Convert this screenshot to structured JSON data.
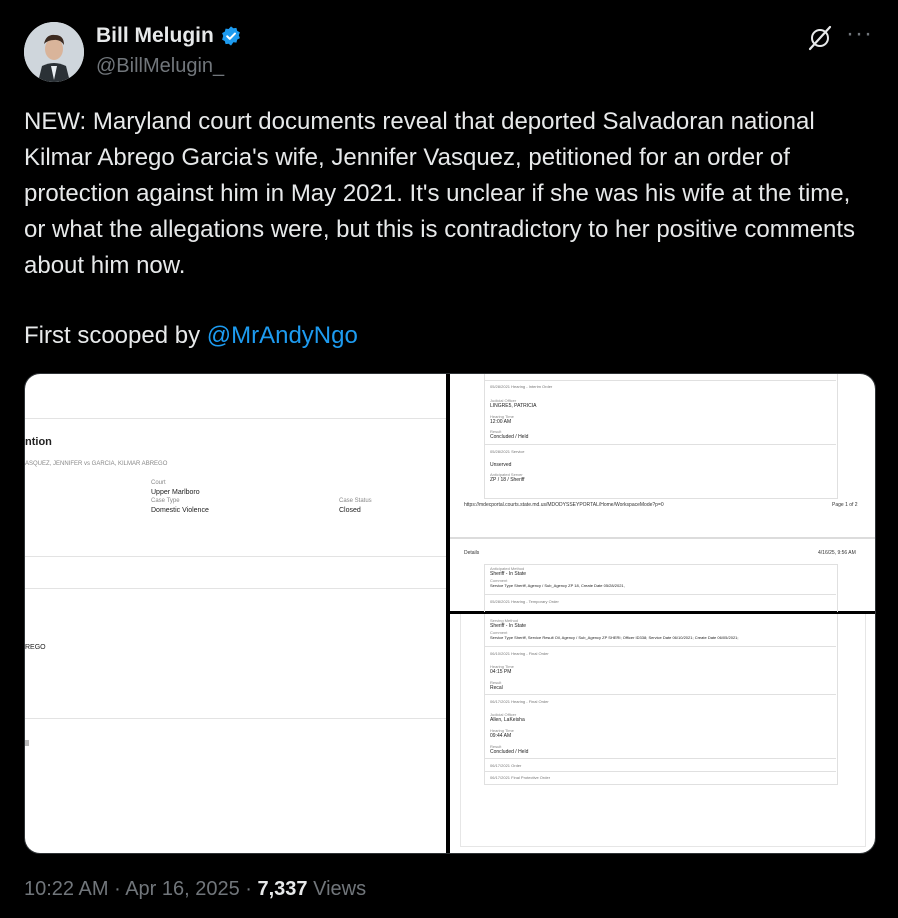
{
  "author": {
    "name": "Bill Melugin",
    "handle": "@BillMelugin_",
    "verified": true
  },
  "icons": {
    "verified": "verified-badge-icon",
    "grok": "grok-icon",
    "more": "more-options-icon"
  },
  "colors": {
    "link": "#1d9bf0",
    "verified": "#1d9bf0",
    "muted": "#71767b",
    "background": "#000000"
  },
  "tweet": {
    "text": "NEW: Maryland court documents reveal that deported Salvadoran national Kilmar Abrego Garcia's wife, Jennifer Vasquez, petitioned for an order of protection against him in May 2021. It's unclear if she was his wife at the time, or what the allegations were, but this is contradictory to her positive comments about him now.",
    "scoop_prefix": "First scooped by ",
    "scoop_mention": "@MrAndyNgo"
  },
  "media": {
    "left": {
      "heading": "ntion",
      "case_title": "ASQUEZ, JENNIFER vs GARCIA, KILMAR ABREGO",
      "court_label": "Court",
      "court_value": "Upper Marlboro",
      "case_type_label": "Case Type",
      "case_type_value": "Domestic Violence",
      "case_status_label": "Case Status",
      "case_status_value": "Closed",
      "party_fragment": "REGO"
    },
    "top_right": {
      "line1": "05/28/2021 Hearing - Interim Order",
      "judicial_label": "Judicial Officer",
      "judicial_value": "LINGRE5, PATRICIA",
      "hearing_time_label": "Hearing Time",
      "hearing_time_value": "12:00 AM",
      "result_label": "Result",
      "result_value": "Concluded / Held",
      "service_line": "05/28/2021 Service",
      "unserved": "Unserved",
      "anticipated_label": "Anticipated Server",
      "anticipated_value": "ZP / 18 / Sheriff",
      "url": "https://mdecportal.courts.state.md.us/MDODYSSEYPORTAL/Home/WorkspaceMode?p=0",
      "page": "Page 1 of 2",
      "details": "Details",
      "date": "4/16/25, 9:56 AM",
      "method_label": "Anticipated Method",
      "method_value": "Sheriff - In State",
      "comment_label": "Comment",
      "comment_value": "Service Type Sheriff, Agency / Sub_Agency ZP 18, Create Date 05/28/2021,",
      "temp_order": "05/28/2021 Hearing - Temporary Order"
    },
    "bottom_right": {
      "method_label": "Serving Method",
      "method_value": "Sheriff - In State",
      "comment_label": "Comment",
      "comment_value": "Service Type Sheriff, Service Result Oil, Agency / Sub_Agency ZP SHERI; Officer ID338; Service Date 06/10/2021; Create Date 06/05/2021;",
      "final_order1": "06/10/2021 Hearing - Final Order",
      "hearing_time_label": "Hearing Time",
      "hearing_time_value": "04:15 PM",
      "result_label": "Result",
      "result_value": "Recal",
      "final_order2": "06/17/2021 Hearing - Final Order",
      "judicial_label": "Judicial Officer",
      "judicial_value": "Allen, LaKeisha",
      "hearing_time2_label": "Hearing Time",
      "hearing_time2_value": "09:44 AM",
      "result2_label": "Result",
      "result2_value": "Concluded / Held",
      "order_line": "06/17/2021 Order",
      "protective_order": "06/17/2021 Final Protective Order"
    }
  },
  "footer": {
    "time": "10:22 AM",
    "sep1": " · ",
    "date": "Apr 16, 2025",
    "sep2": " · ",
    "views_count": "7,337",
    "views_label": " Views"
  }
}
